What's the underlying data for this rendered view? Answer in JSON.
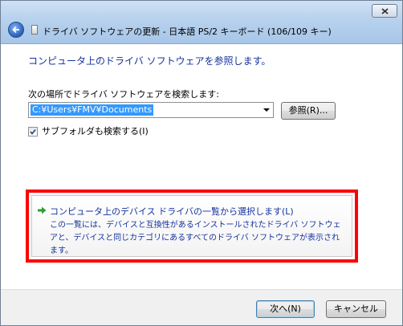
{
  "window": {
    "title": "ドライバ ソフトウェアの更新 - 日本語 PS/2 キーボード (106/109 キー)"
  },
  "page": {
    "heading": "コンピュータ上のドライバ ソフトウェアを参照します。",
    "search_label": "次の場所でドライバ ソフトウェアを検索します:",
    "path_value": "C:¥Users¥FMV¥Documents",
    "browse_label": "参照(R)...",
    "subfolder_label": "サブフォルダも検索する(I)",
    "subfolder_checked": true
  },
  "option": {
    "title": "コンピュータ上のデバイス ドライバの一覧から選択します(L)",
    "description": "この一覧には、デバイスと互換性があるインストールされたドライバ ソフトウェアと、デバイスと同じカテゴリにあるすべてのドライバ ソフトウェアが表示されます。"
  },
  "footer": {
    "next_label": "次へ(N)",
    "cancel_label": "キャンセル"
  },
  "icons": {
    "close": "close-icon",
    "back": "back-arrow-icon",
    "title": "document-icon",
    "option_arrow": "green-arrow-icon",
    "checkbox": "checkmark-icon",
    "dropdown": "chevron-down-icon"
  },
  "colors": {
    "heading_blue": "#14329c",
    "selection": "#3399ff",
    "highlight_red": "#ff0000",
    "arrow_green": "#2e9e2e"
  }
}
